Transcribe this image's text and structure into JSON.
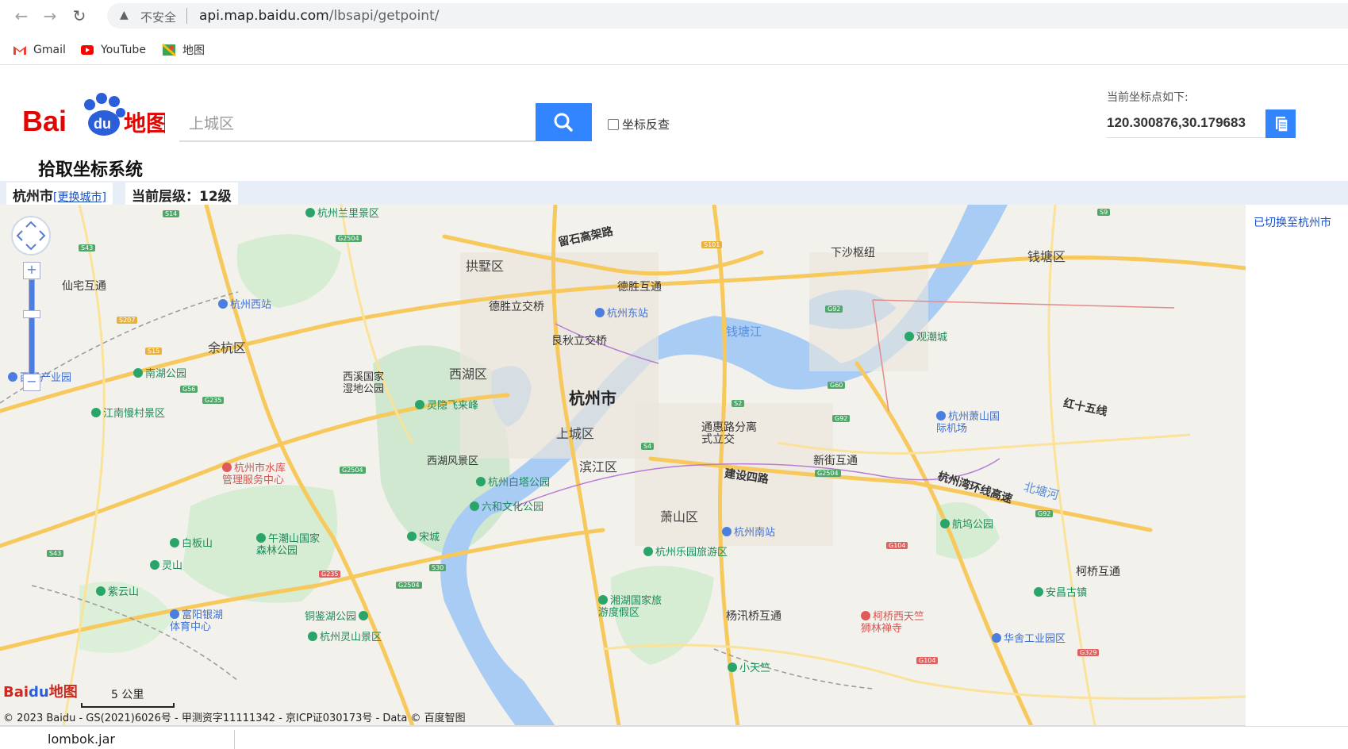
{
  "browser": {
    "security": "不安全",
    "url_host": "api.map.baidu.com",
    "url_path": "/lbsapi/getpoint/",
    "bookmarks": [
      {
        "label": "Gmail",
        "icon": "gmail-icon"
      },
      {
        "label": "YouTube",
        "icon": "youtube-icon"
      },
      {
        "label": "地图",
        "icon": "maps-icon"
      }
    ]
  },
  "header": {
    "logo_brand": "Bai du 地图",
    "logo_subtitle": "拾取坐标系统",
    "search_value": "上城区",
    "reverse_label": "坐标反查",
    "coord_label": "当前坐标点如下:",
    "coord_value": "120.300876,30.179683",
    "accent": "#3385ff"
  },
  "status": {
    "city": "杭州市",
    "change_city": "[更换城市]",
    "level": "当前层级：12级"
  },
  "map": {
    "center_city": "杭州市",
    "districts": [
      "拱墅区",
      "西湖区",
      "余杭区",
      "上城区",
      "滨江区",
      "萧山区",
      "钱塘区"
    ],
    "roads": [
      "留石高架路",
      "德胜互通",
      "德胜立交桥",
      "艮秋立交桥",
      "下沙枢纽",
      "建设四路",
      "新街互通",
      "红十五线",
      "杭州湾环线高速",
      "通惠路分离式立交",
      "仙宅互通",
      "柯桥互通",
      "杨汛桥互通"
    ],
    "water": [
      "钱塘江",
      "北塘河"
    ],
    "pois": [
      "杭州兰里景区",
      "杭州西站",
      "南湖公园",
      "西子产业园",
      "江南慢村景区",
      "西溪国家湿地公园",
      "灵隐飞来峰",
      "西湖风景区",
      "杭州东站",
      "观潮城",
      "杭州萧山国际机场",
      "杭州白塔公园",
      "六和文化公园",
      "杭州市水库管理服务中心",
      "白板山",
      "午潮山国家森林公园",
      "宋城",
      "灵山",
      "紫云山",
      "富阳银湖体育中心",
      "铜鉴湖公园",
      "杭州灵山景区",
      "湘湖国家旅游度假区",
      "杭州乐园旅游区",
      "杭州南站",
      "航坞公园",
      "安昌古镇",
      "柯桥西天竺狮林禅寺",
      "华舍工业园区",
      "小天竺"
    ],
    "scale": "5 公里",
    "copyright": "© 2023 Baidu - GS(2021)6026号 - 甲测资字11111342 - 京ICP证030173号 - Data © 百度智图",
    "switched_notice": "已切换至杭州市"
  },
  "downloads": {
    "file": "lombok.jar"
  }
}
